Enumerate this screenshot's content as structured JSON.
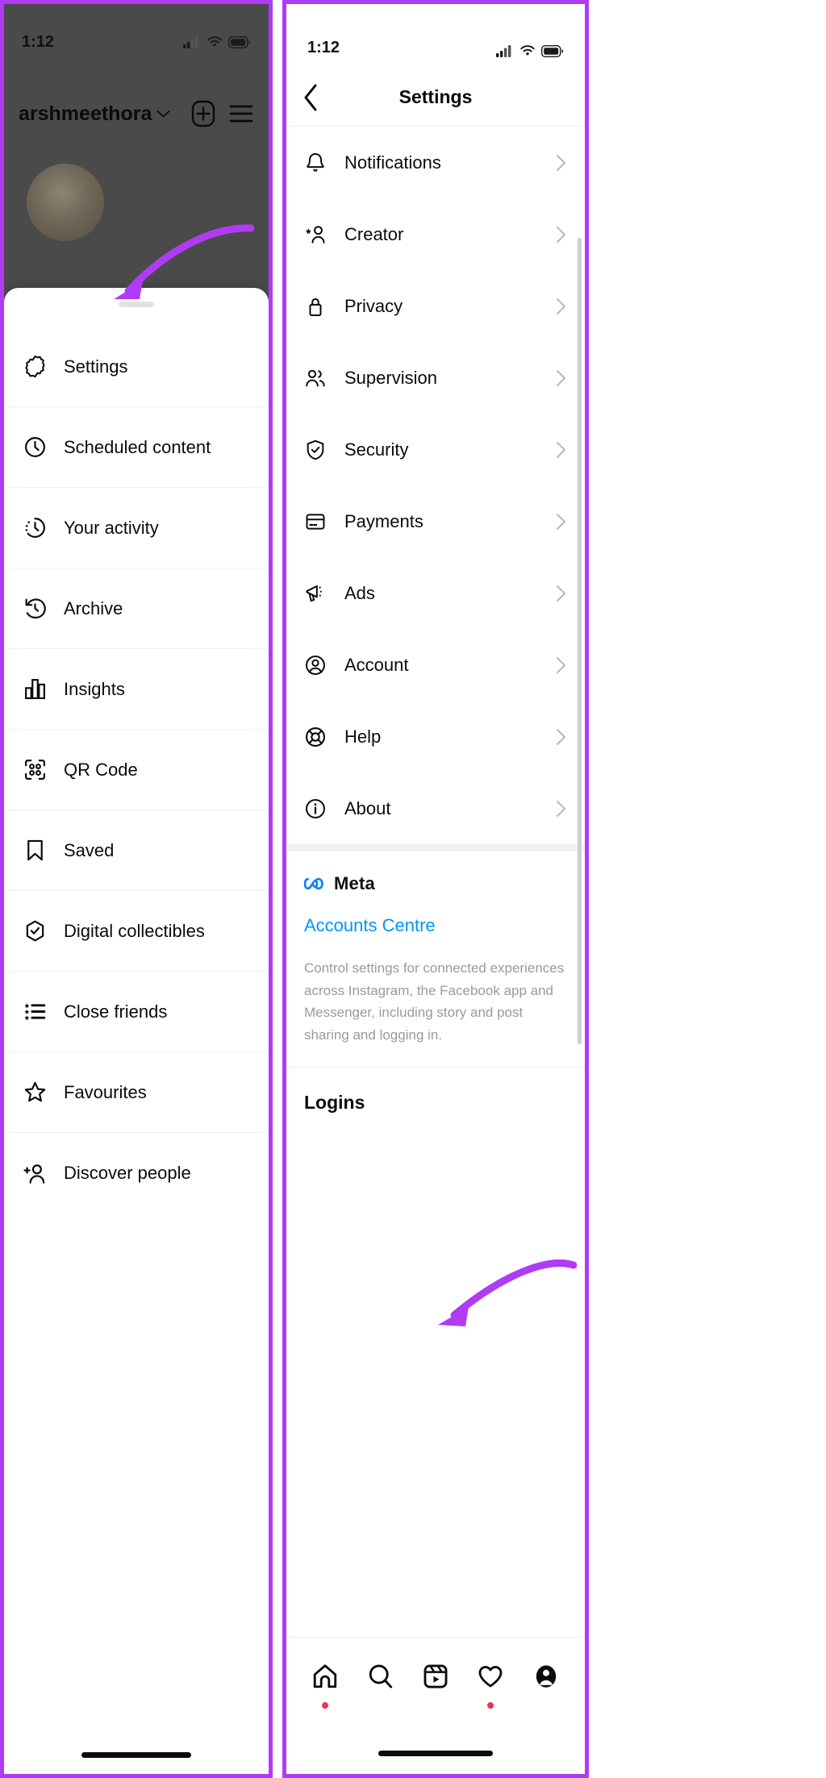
{
  "left_phone": {
    "status_bar": {
      "time": "1:12",
      "icons": [
        "cellular-signal-icon",
        "wifi-icon",
        "battery-icon"
      ]
    },
    "profile_header": {
      "username": "arshmeethora",
      "chevron": "chevron-down-icon",
      "actions": [
        "new-post-icon",
        "hamburger-menu-icon"
      ]
    },
    "sheet": {
      "grabber": "drag-handle",
      "items": [
        {
          "icon": "gear-icon",
          "label": "Settings"
        },
        {
          "icon": "clock-icon",
          "label": "Scheduled content"
        },
        {
          "icon": "activity-icon",
          "label": "Your activity"
        },
        {
          "icon": "archive-icon",
          "label": "Archive"
        },
        {
          "icon": "insights-icon",
          "label": "Insights"
        },
        {
          "icon": "qr-code-icon",
          "label": "QR Code"
        },
        {
          "icon": "bookmark-icon",
          "label": "Saved"
        },
        {
          "icon": "collectibles-icon",
          "label": "Digital collectibles"
        },
        {
          "icon": "close-friends-icon",
          "label": "Close friends"
        },
        {
          "icon": "star-icon",
          "label": "Favourites"
        },
        {
          "icon": "add-person-icon",
          "label": "Discover people"
        }
      ]
    }
  },
  "right_phone": {
    "status_bar": {
      "time": "1:12",
      "icons": [
        "cellular-signal-icon",
        "wifi-icon",
        "battery-icon"
      ]
    },
    "nav": {
      "back": "back-chevron-icon",
      "title": "Settings"
    },
    "settings_rows": [
      {
        "icon": "bell-icon",
        "label": "Notifications"
      },
      {
        "icon": "creator-icon",
        "label": "Creator"
      },
      {
        "icon": "lock-icon",
        "label": "Privacy"
      },
      {
        "icon": "supervision-icon",
        "label": "Supervision"
      },
      {
        "icon": "shield-check-icon",
        "label": "Security"
      },
      {
        "icon": "card-icon",
        "label": "Payments"
      },
      {
        "icon": "megaphone-icon",
        "label": "Ads"
      },
      {
        "icon": "account-icon",
        "label": "Account"
      },
      {
        "icon": "life-ring-icon",
        "label": "Help"
      },
      {
        "icon": "info-icon",
        "label": "About"
      }
    ],
    "meta_block": {
      "logo_icon": "meta-infinity-icon",
      "brand": "Meta",
      "link": "Accounts Centre",
      "description": "Control settings for connected experiences across Instagram, the Facebook app and Messenger, including story and post sharing and logging in."
    },
    "logins_section": {
      "title": "Logins"
    },
    "tab_bar": [
      {
        "icon": "home-icon",
        "badge": true
      },
      {
        "icon": "search-icon",
        "badge": false
      },
      {
        "icon": "reels-icon",
        "badge": false
      },
      {
        "icon": "heart-icon",
        "badge": true
      },
      {
        "icon": "profile-avatar-icon",
        "badge": false
      }
    ]
  },
  "annotations": {
    "arrow_color": "#b03bf5",
    "left_arrow_target": "Settings",
    "right_arrow_target": "Accounts Centre"
  },
  "colors": {
    "frame_purple": "#b03bf5",
    "link_blue": "#0095f6",
    "meta_blue": "#0081FB",
    "badge_red": "#fe2c55",
    "backdrop_gray": "#4a4a4a"
  }
}
